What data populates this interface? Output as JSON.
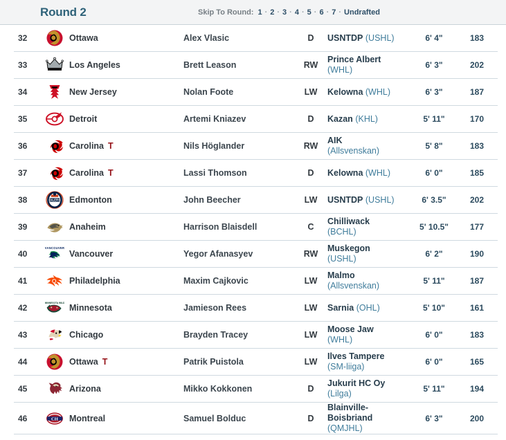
{
  "header": {
    "round_title": "Round 2",
    "skip_label": "Skip To Round:",
    "skip_separator": "·",
    "skip_options": [
      "1",
      "2",
      "3",
      "4",
      "5",
      "6",
      "7",
      "Undrafted"
    ]
  },
  "colors": {
    "header_bg": "#f3f4f5",
    "round_title": "#2e6279",
    "trade_flag": "#96131a",
    "league_text": "#3f7c9b",
    "row_border": "#cfd9e0"
  },
  "trade_flag_label": "T",
  "picks": [
    {
      "number": "32",
      "team": "Ottawa",
      "traded": false,
      "logo": "senators-logo",
      "player": "Alex Vlasic",
      "position": "D",
      "club": "USNTDP",
      "league": "(USHL)",
      "club_wraps": false,
      "height": "6' 4\"",
      "weight": "183"
    },
    {
      "number": "33",
      "team": "Los Angeles",
      "traded": false,
      "logo": "kings-logo",
      "player": "Brett Leason",
      "position": "RW",
      "club": "Prince Albert",
      "league": "(WHL)",
      "club_wraps": true,
      "height": "6' 3\"",
      "weight": "202"
    },
    {
      "number": "34",
      "team": "New Jersey",
      "traded": false,
      "logo": "devils-logo",
      "player": "Nolan Foote",
      "position": "LW",
      "club": "Kelowna",
      "league": "(WHL)",
      "club_wraps": false,
      "height": "6' 3\"",
      "weight": "187"
    },
    {
      "number": "35",
      "team": "Detroit",
      "traded": false,
      "logo": "red-wings-logo",
      "player": "Artemi Kniazev",
      "position": "D",
      "club": "Kazan",
      "league": "(KHL)",
      "club_wraps": false,
      "height": "5' 11\"",
      "weight": "170"
    },
    {
      "number": "36",
      "team": "Carolina",
      "traded": true,
      "logo": "hurricanes-logo",
      "player": "Nils Höglander",
      "position": "RW",
      "club": "AIK",
      "league": "(Allsvenskan)",
      "club_wraps": true,
      "height": "5' 8\"",
      "weight": "183"
    },
    {
      "number": "37",
      "team": "Carolina",
      "traded": true,
      "logo": "hurricanes-logo",
      "player": "Lassi Thomson",
      "position": "D",
      "club": "Kelowna",
      "league": "(WHL)",
      "club_wraps": false,
      "height": "6' 0\"",
      "weight": "185"
    },
    {
      "number": "38",
      "team": "Edmonton",
      "traded": false,
      "logo": "oilers-logo",
      "player": "John Beecher",
      "position": "LW",
      "club": "USNTDP",
      "league": "(USHL)",
      "club_wraps": false,
      "height": "6' 3.5\"",
      "weight": "202"
    },
    {
      "number": "39",
      "team": "Anaheim",
      "traded": false,
      "logo": "ducks-logo",
      "player": "Harrison Blaisdell",
      "position": "C",
      "club": "Chilliwack",
      "league": "(BCHL)",
      "club_wraps": true,
      "height": "5' 10.5\"",
      "weight": "177"
    },
    {
      "number": "40",
      "team": "Vancouver",
      "traded": false,
      "logo": "canucks-logo",
      "player": "Yegor Afanasyev",
      "position": "RW",
      "club": "Muskegon",
      "league": "(USHL)",
      "club_wraps": true,
      "height": "6' 2\"",
      "weight": "190"
    },
    {
      "number": "41",
      "team": "Philadelphia",
      "traded": false,
      "logo": "flyers-logo",
      "player": "Maxim Cajkovic",
      "position": "LW",
      "club": "Malmo",
      "league": "(Allsvenskan)",
      "club_wraps": true,
      "height": "5' 11\"",
      "weight": "187"
    },
    {
      "number": "42",
      "team": "Minnesota",
      "traded": false,
      "logo": "wild-logo",
      "player": "Jamieson Rees",
      "position": "LW",
      "club": "Sarnia",
      "league": "(OHL)",
      "club_wraps": false,
      "height": "5' 10\"",
      "weight": "161"
    },
    {
      "number": "43",
      "team": "Chicago",
      "traded": false,
      "logo": "blackhawks-logo",
      "player": "Brayden Tracey",
      "position": "LW",
      "club": "Moose Jaw",
      "league": "(WHL)",
      "club_wraps": true,
      "height": "6' 0\"",
      "weight": "183"
    },
    {
      "number": "44",
      "team": "Ottawa",
      "traded": true,
      "logo": "senators-logo",
      "player": "Patrik Puistola",
      "position": "LW",
      "club": "Ilves Tampere",
      "league": "(SM-liiga)",
      "club_wraps": true,
      "height": "6' 0\"",
      "weight": "165"
    },
    {
      "number": "45",
      "team": "Arizona",
      "traded": false,
      "logo": "coyotes-logo",
      "player": "Mikko Kokkonen",
      "position": "D",
      "club": "Jukurit HC Oy",
      "league": "(Lilga)",
      "club_wraps": true,
      "height": "5' 11\"",
      "weight": "194"
    },
    {
      "number": "46",
      "team": "Montreal",
      "traded": false,
      "logo": "canadiens-logo",
      "player": "Samuel Bolduc",
      "position": "D",
      "club": "Blainville-\nBoisbriand",
      "league": "(QMJHL)",
      "club_wraps": true,
      "height": "6' 3\"",
      "weight": "200"
    }
  ]
}
